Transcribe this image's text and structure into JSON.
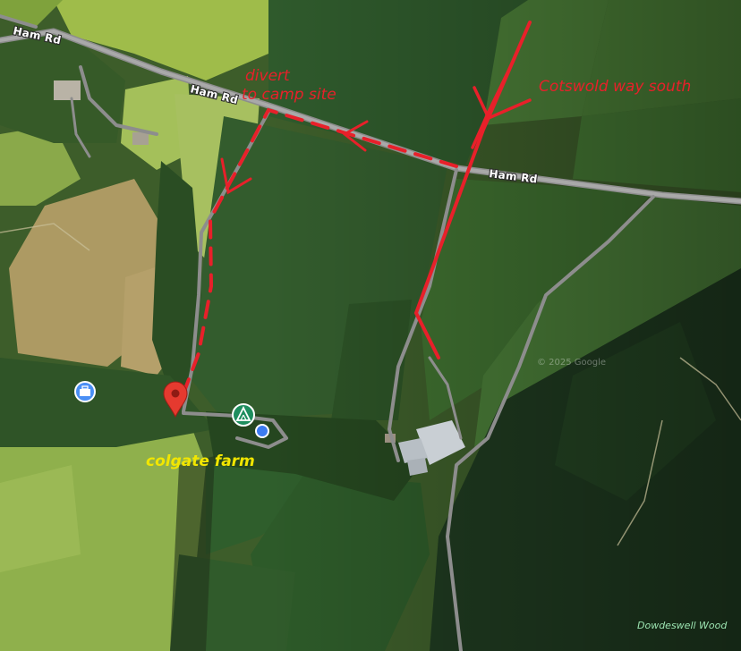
{
  "map": {
    "type": "satellite-hybrid",
    "road_labels": [
      "Ham Rd",
      "Ham Rd",
      "Ham Rd"
    ],
    "place_label": "Dowdeswell Wood",
    "watermark": "© 2025 Google"
  },
  "annotations": {
    "divert_line1": "divert",
    "divert_line2": "to camp site",
    "route_label": "Cotswold way south",
    "farm_label": "colgate farm",
    "annotation_color": "#e8202a",
    "farm_label_color": "#f2e600"
  },
  "markers": {
    "location_pin": "red-location-pin-icon",
    "camp_site": "campground-triangle-icon",
    "business": "briefcase-icon",
    "place": "blue-dot-icon"
  }
}
